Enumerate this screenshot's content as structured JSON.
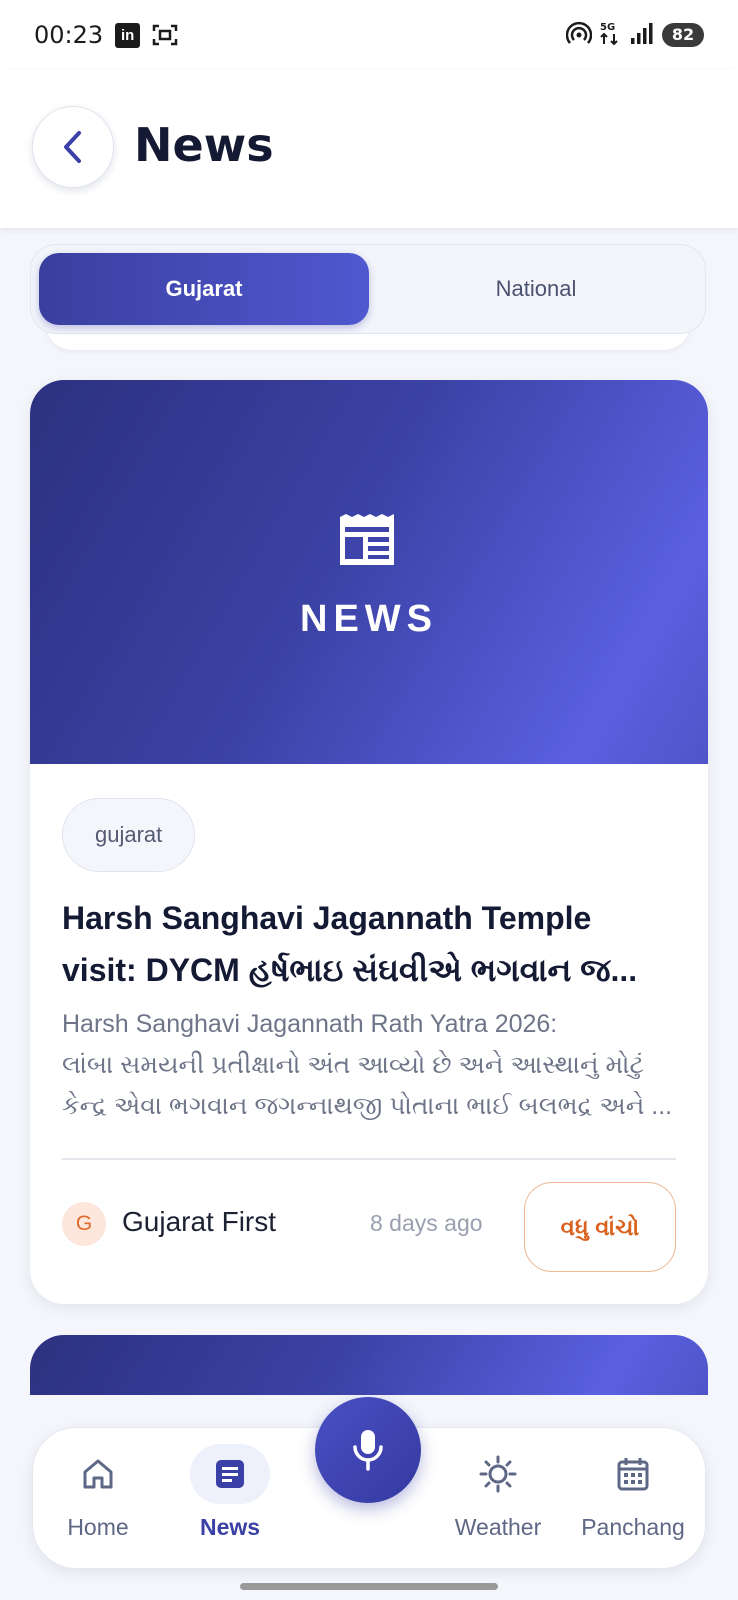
{
  "status_bar": {
    "time": "00:23",
    "battery": "82",
    "network": "5G"
  },
  "header": {
    "title": "News"
  },
  "tabs": [
    {
      "label": "Gujarat",
      "active": true
    },
    {
      "label": "National",
      "active": false
    }
  ],
  "article": {
    "hero_label": "NEWS",
    "category": "gujarat",
    "headline_lines": [
      "Harsh Sanghavi Jagannath Temple",
      "visit: DYCM હર્ષભાઇ સંઘવીએ ભગવાન જ..."
    ],
    "summary_lines": [
      "Harsh Sanghavi Jagannath Rath Yatra 2026:",
      "લાંબા સમયની પ્રતીક્ષાનો અંત આવ્યો છે અને આસ્થાનું મોટું",
      "કેન્દ્ર એવા ભગવાન જગન્નાથજી પોતાના ભાઈ બલભદ્ર અને ..."
    ],
    "source_initial": "G",
    "source_name": "Gujarat First",
    "time_ago": "8 days ago",
    "read_more": "વધુ વાંચો"
  },
  "bottom_nav": [
    {
      "label": "Home",
      "icon": "home-icon",
      "active": false
    },
    {
      "label": "News",
      "icon": "newspaper-icon",
      "active": true
    },
    {
      "label": "Weather",
      "icon": "sun-icon",
      "active": false
    },
    {
      "label": "Panchang",
      "icon": "calendar-icon",
      "active": false
    }
  ],
  "colors": {
    "primary": "#3b40a6",
    "accent_orange": "#d9621e",
    "background": "#f4f6fb"
  }
}
